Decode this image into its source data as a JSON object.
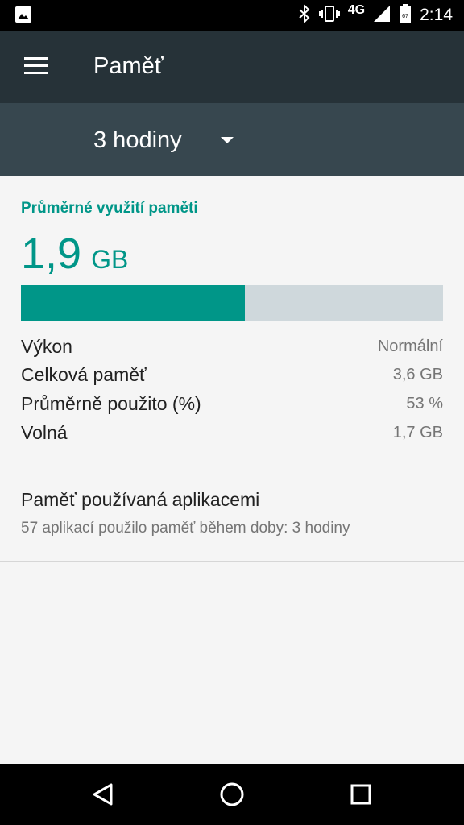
{
  "status_bar": {
    "time": "2:14",
    "network": "4G",
    "battery": "67",
    "icons": [
      "image-icon",
      "bluetooth-icon",
      "vibrate-icon",
      "signal-icon",
      "battery-icon"
    ]
  },
  "app_bar": {
    "title": "Paměť"
  },
  "time_spinner": {
    "selected": "3 hodiny"
  },
  "memory": {
    "section_title": "Průměrné využití paměti",
    "value": "1,9",
    "unit": "GB",
    "usage_fraction": 0.53,
    "rows": [
      {
        "label": "Výkon",
        "value": "Normální"
      },
      {
        "label": "Celková paměť",
        "value": "3,6 GB"
      },
      {
        "label": "Průměrně použito (%)",
        "value": "53 %"
      },
      {
        "label": "Volná",
        "value": "1,7 GB"
      }
    ]
  },
  "apps": {
    "title": "Paměť používaná aplikacemi",
    "subtitle": "57 aplikací použilo paměť během doby: 3 hodiny"
  },
  "colors": {
    "accent": "#009688",
    "toolbar": "#263238",
    "spinner_bar": "#37474f",
    "track": "#cfd8dc"
  }
}
